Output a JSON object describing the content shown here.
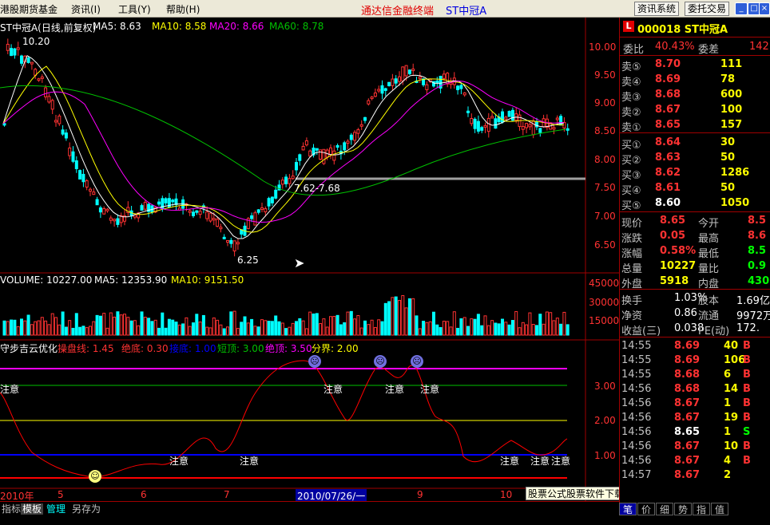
{
  "menu": {
    "items": [
      {
        "label": "港股期货基金",
        "x": 0
      },
      {
        "label": "资讯(I)",
        "x": 89
      },
      {
        "label": "工具(Y)",
        "x": 148
      },
      {
        "label": "帮助(H)",
        "x": 208
      }
    ],
    "title": "通达信金融终端",
    "title_stock": "ST中冠A",
    "btn_news": "资讯系统",
    "btn_trade": "委托交易",
    "win_min": "_",
    "win_max": "□",
    "win_close": "×"
  },
  "main": {
    "title": "ST中冠A(日线,前复权)",
    "ma5": "MA5: 8.63",
    "ma10": "MA10: 8.58",
    "ma20": "MA20: 8.66",
    "ma60": "MA60: 8.78",
    "high_label": "10.20",
    "low_label": "6.25",
    "range_label": "7.62-7.68",
    "y_ticks": [
      "10.00",
      "9.50",
      "9.00",
      "8.50",
      "8.00",
      "7.50",
      "7.00",
      "6.50"
    ]
  },
  "volume": {
    "title": "VOLUME: 10227.00",
    "ma5": "MA5: 12353.90",
    "ma10": "MA10: 9151.50",
    "y_ticks": [
      "45000",
      "30000",
      "15000"
    ]
  },
  "indicator": {
    "title": "守步吉云优化",
    "line1": "操盘线: 1.45",
    "line2": "绝底: 0.30",
    "line3": "接底: 1.00",
    "line4": "短顶: 3.00",
    "line5": "绝顶: 3.50",
    "line6": "分界: 2.00",
    "y_ticks": [
      "3.00",
      "2.00",
      "1.00"
    ],
    "note": "注意"
  },
  "x_axis": {
    "labels": [
      "2010年",
      "5",
      "6",
      "7",
      "9",
      "10"
    ],
    "cursor_date": "2010/07/26/一"
  },
  "tabs": [
    "指标",
    "模板",
    "管理",
    "另存为"
  ],
  "watermark": "股票公式股票软件下载[分析家公式网www.88gs.com]",
  "panel": {
    "code_badge": "L",
    "code": "000018 ST中冠A",
    "webi_label": "委比",
    "webi_value": "40.43%",
    "wecha_label": "委差",
    "wecha_value": "142",
    "asks": [
      {
        "label": "卖⑤",
        "price": "8.70",
        "vol": "111"
      },
      {
        "label": "卖④",
        "price": "8.69",
        "vol": "78"
      },
      {
        "label": "卖③",
        "price": "8.68",
        "vol": "600"
      },
      {
        "label": "卖②",
        "price": "8.67",
        "vol": "100"
      },
      {
        "label": "卖①",
        "price": "8.65",
        "vol": "157"
      }
    ],
    "bids": [
      {
        "label": "买①",
        "price": "8.64",
        "vol": "30"
      },
      {
        "label": "买②",
        "price": "8.63",
        "vol": "50"
      },
      {
        "label": "买③",
        "price": "8.62",
        "vol": "1286"
      },
      {
        "label": "买④",
        "price": "8.61",
        "vol": "50"
      },
      {
        "label": "买⑤",
        "price": "8.60",
        "vol": "1050"
      }
    ],
    "stats": [
      {
        "l1": "现价",
        "v1": "8.65",
        "l2": "今开",
        "v2": "8.5"
      },
      {
        "l1": "涨跌",
        "v1": "0.05",
        "l2": "最高",
        "v2": "8.6"
      },
      {
        "l1": "涨幅",
        "v1": "0.58%",
        "l2": "最低",
        "v2": "8.5"
      },
      {
        "l1": "总量",
        "v1": "10227",
        "l2": "量比",
        "v2": "0.9"
      },
      {
        "l1": "外盘",
        "v1": "5918",
        "l2": "内盘",
        "v2": "430"
      }
    ],
    "stats2": [
      {
        "l1": "换手",
        "v1": "1.03%",
        "l2": "股本",
        "v2": "1.69亿"
      },
      {
        "l1": "净资",
        "v1": "0.86",
        "l2": "流通",
        "v2": "9972万"
      },
      {
        "l1": "收益(三)",
        "v1": "0.038",
        "l2": "PE(动)",
        "v2": "172."
      }
    ],
    "ticks": [
      {
        "time": "14:55",
        "price": "8.69",
        "vol": "40",
        "side": "B"
      },
      {
        "time": "14:55",
        "price": "8.69",
        "vol": "106",
        "side": "B"
      },
      {
        "time": "14:55",
        "price": "8.68",
        "vol": "6",
        "side": "B"
      },
      {
        "time": "14:56",
        "price": "8.68",
        "vol": "14",
        "side": "B"
      },
      {
        "time": "14:56",
        "price": "8.67",
        "vol": "1",
        "side": "B"
      },
      {
        "time": "14:56",
        "price": "8.67",
        "vol": "19",
        "side": "B"
      },
      {
        "time": "14:56",
        "price": "8.65",
        "vol": "1",
        "side": "S"
      },
      {
        "time": "14:56",
        "price": "8.67",
        "vol": "10",
        "side": "B"
      },
      {
        "time": "14:56",
        "price": "8.67",
        "vol": "4",
        "side": "B"
      },
      {
        "time": "14:57",
        "price": "8.67",
        "vol": "2",
        "side": ""
      }
    ],
    "bottom_tabs": [
      "笔",
      "价",
      "细",
      "势",
      "指",
      "值"
    ]
  },
  "colors": {
    "up": "#ff3232",
    "down": "#00ffff",
    "ma5": "#ffffff",
    "ma10": "#ffff00",
    "ma20": "#ff00ff",
    "ma60": "#00c000"
  }
}
